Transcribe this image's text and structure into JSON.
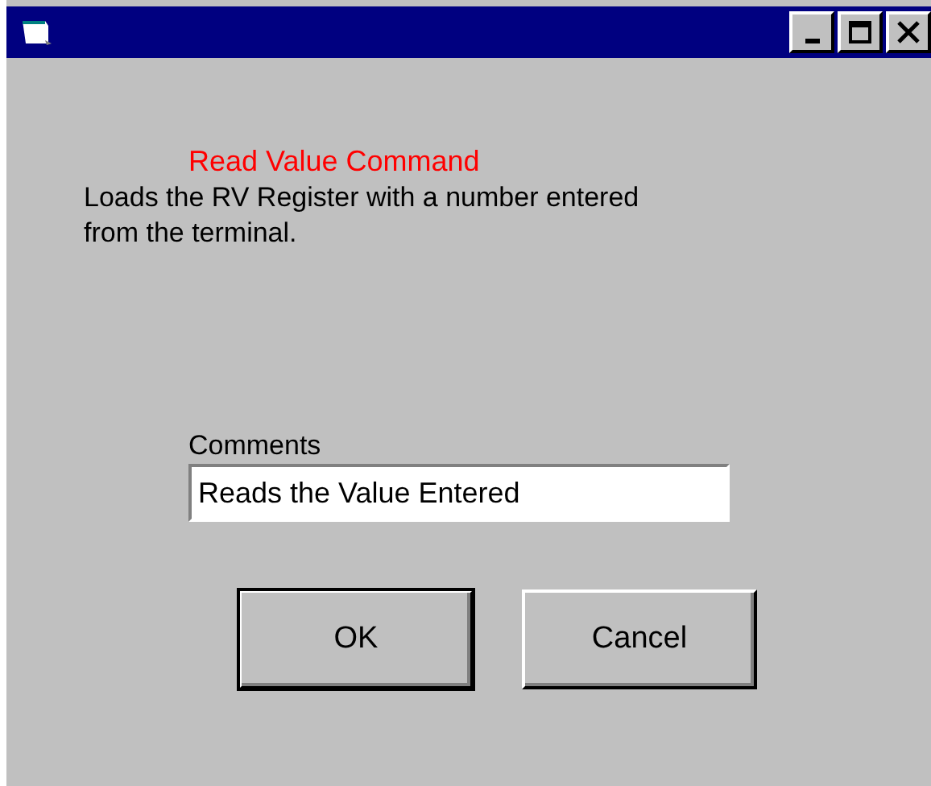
{
  "heading": "Read Value Command",
  "description": "Loads the RV Register with a number entered from the terminal.",
  "comments": {
    "label": "Comments",
    "value": "Reads the Value Entered"
  },
  "buttons": [
    {
      "label": "OK",
      "default": true
    },
    {
      "label": "Cancel",
      "default": false
    }
  ]
}
